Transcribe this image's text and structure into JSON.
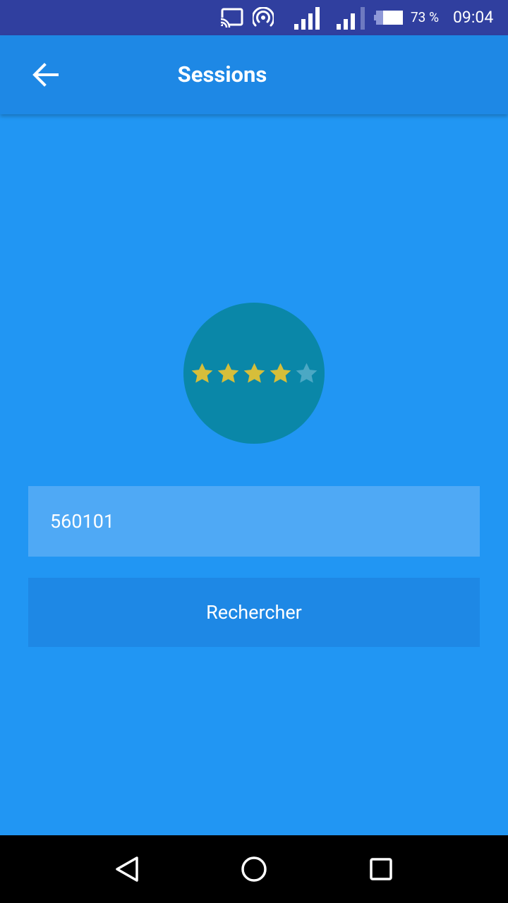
{
  "status_bar": {
    "battery_percent": "73 %",
    "time": "09:04",
    "icons": [
      "cast-icon",
      "hotspot-icon",
      "signal-icon",
      "signal-icon",
      "battery-icon"
    ]
  },
  "app_bar": {
    "title": "Sessions",
    "back_icon": "arrow-left-icon"
  },
  "rating": {
    "value": 4,
    "max": 5,
    "filled_color": "#D6BE3A",
    "empty_color": "#4BA8C4",
    "circle_color": "#0A87A8"
  },
  "code_field": {
    "value": "560101"
  },
  "search_button": {
    "label": "Rechercher"
  },
  "nav_bar": {
    "icons": [
      "back-triangle-icon",
      "home-circle-icon",
      "recents-square-icon"
    ]
  },
  "colors": {
    "status_bar": "#303F9F",
    "app_bar": "#1E88E5",
    "background": "#2196F3",
    "field": "#4FA9F5",
    "button": "#1E88E5"
  }
}
